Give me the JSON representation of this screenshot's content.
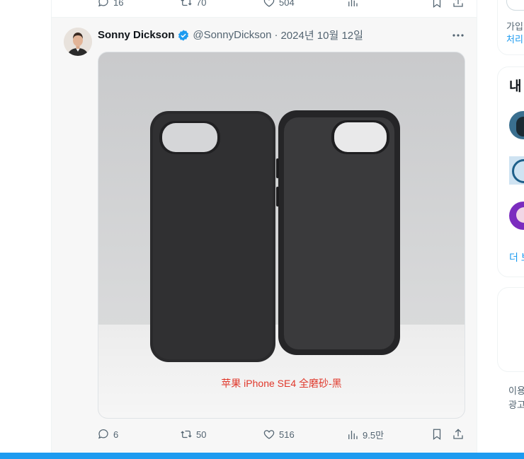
{
  "prev_tweet": {
    "reply_count": "16",
    "retweet_count": "70",
    "like_count": "504"
  },
  "tweet": {
    "author_name": "Sonny Dickson",
    "handle": "@SonnyDickson",
    "separator": "·",
    "date": "2024년 10월 12일",
    "image_caption": "苹果 iPhone SE4 全磨砂-黑",
    "reply_count": "6",
    "retweet_count": "50",
    "like_count": "516",
    "view_count": "9.5만"
  },
  "sidebar": {
    "signup_text": "가입",
    "signup_link": "처리",
    "section_title": "내",
    "more_link": "더 보",
    "footer_line1": "이용",
    "footer_line2": "광고"
  },
  "colors": {
    "accent": "#1d9bf0",
    "caption_red": "#e0372a",
    "muted_text": "#536471"
  },
  "icons": [
    "reply-icon",
    "retweet-icon",
    "like-icon",
    "views-icon",
    "bookmark-icon",
    "share-icon",
    "verified-badge-icon",
    "more-icon"
  ]
}
